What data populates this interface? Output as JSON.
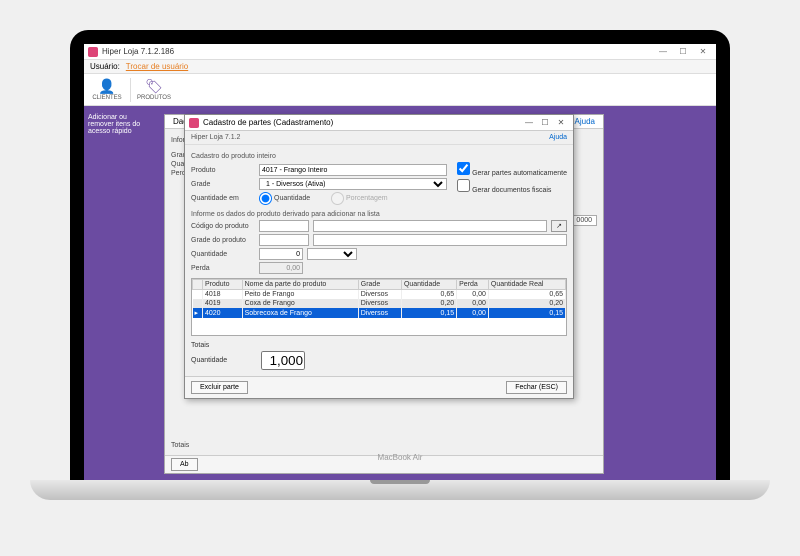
{
  "mainWindow": {
    "title": "Hiper Loja 7.1.2.186",
    "userbar": {
      "label": "Usuário:",
      "changeUser": "Trocar de usuário"
    },
    "toolbar": {
      "clientes": "CLIENTES",
      "produtos": "PRODUTOS"
    },
    "sidebar": {
      "quickaccess": "Adicionar ou remover itens do acesso rápido"
    }
  },
  "bgWindow": {
    "titlePrefix": "Dad",
    "labels": {
      "informe": "Informe",
      "grad": "Grad",
      "quant": "Quant",
      "perda": "Perda",
      "totais": "Totais"
    },
    "bottomBtn": "Ab",
    "right": {
      "ajuda": "Ajuda",
      "sval": "0000"
    }
  },
  "dialog": {
    "title": "Cadastro de partes (Cadastramento)",
    "subtitle": "Hiper Loja 7.1.2",
    "ajuda": "Ajuda",
    "section1": "Cadastro do produto inteiro",
    "produto_label": "Produto",
    "produto_value": "4017 - Frango Inteiro",
    "grade_label": "Grade",
    "grade_value": "1 - Diversos (Ativa)",
    "qtd_em_label": "Quantidade em",
    "radio_qtd": "Quantidade",
    "radio_pct": "Porcentagem",
    "cb_auto": "Gerar partes automaticamente",
    "cb_fiscais": "Gerar documentos fiscais",
    "section2": "Informe os dados do produto derivado para adicionar na lista",
    "codigo_label": "Código do produto",
    "grade2_label": "Grade do produto",
    "qtd_label": "Quantidade",
    "qtd_value": "0",
    "perda_label": "Perda",
    "perda_value": "0,00",
    "table": {
      "headers": [
        "Produto",
        "Nome da parte do produto",
        "Grade",
        "Quantidade",
        "Perda",
        "Quantidade Real"
      ],
      "rows": [
        {
          "produto": "4018",
          "nome": "Peito de Frango",
          "grade": "Diversos",
          "qtd": "0,65",
          "perda": "0,00",
          "real": "0,65",
          "sel": false,
          "alt": false
        },
        {
          "produto": "4019",
          "nome": "Coxa de Frango",
          "grade": "Diversos",
          "qtd": "0,20",
          "perda": "0,00",
          "real": "0,20",
          "sel": false,
          "alt": true
        },
        {
          "produto": "4020",
          "nome": "Sobrecoxa de Frango",
          "grade": "Diversos",
          "qtd": "0,15",
          "perda": "0,00",
          "real": "0,15",
          "sel": true,
          "alt": false
        }
      ]
    },
    "totals": {
      "label": "Totais",
      "qtd_label": "Quantidade",
      "qtd_value": "1,000"
    },
    "footer": {
      "excluir": "Excluir parte",
      "fechar": "Fechar (ESC)"
    }
  },
  "laptop": {
    "brand": "MacBook Air"
  }
}
